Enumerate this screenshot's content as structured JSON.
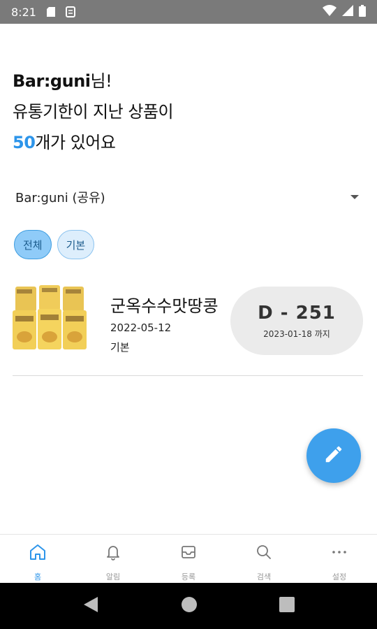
{
  "status_bar": {
    "time": "8:21"
  },
  "header": {
    "user_name": "Bar:guni",
    "user_suffix": "님!",
    "line2": "유통기한이 지난 상품이",
    "count": "50",
    "line3_suffix": "개가 있어요"
  },
  "dropdown": {
    "selected": "Bar:guni (공유)"
  },
  "chips": [
    {
      "label": "전체"
    },
    {
      "label": "기본"
    }
  ],
  "product": {
    "name": "군옥수수맛땅콩",
    "date": "2022-05-12",
    "category": "기본",
    "dday": "D - 251",
    "until": "2023-01-18 까지"
  },
  "bottom_nav": [
    {
      "label": "홈",
      "icon": "home-icon"
    },
    {
      "label": "알림",
      "icon": "bell-icon"
    },
    {
      "label": "등록",
      "icon": "inbox-icon"
    },
    {
      "label": "검색",
      "icon": "search-icon"
    },
    {
      "label": "설정",
      "icon": "more-icon"
    }
  ],
  "colors": {
    "accent": "#2d95ea",
    "fab": "#3ea0ec",
    "chip_active": "#8fcbf8",
    "dday_bg": "#ebebeb"
  }
}
